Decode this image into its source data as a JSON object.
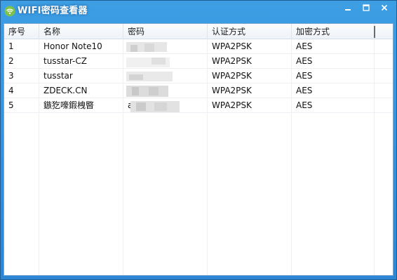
{
  "window": {
    "title": "WIFI密码查看器"
  },
  "table": {
    "columns": [
      "序号",
      "名称",
      "密码",
      "认证方式",
      "加密方式"
    ],
    "rows": [
      {
        "index": "1",
        "name": "Honor Note10",
        "password": "",
        "auth": "WPA2PSK",
        "cipher": "AES"
      },
      {
        "index": "2",
        "name": "tusstar-CZ",
        "password": "",
        "auth": "WPA2PSK",
        "cipher": "AES"
      },
      {
        "index": "3",
        "name": "tusstar",
        "password": "",
        "auth": "WPA2PSK",
        "cipher": "AES"
      },
      {
        "index": "4",
        "name": "ZDECK.CN",
        "password": "",
        "auth": "WPA2PSK",
        "cipher": "AES"
      },
      {
        "index": "5",
        "name": "鏃犵嚎鍜栧暋",
        "password": "a",
        "auth": "WPA2PSK",
        "cipher": "AES"
      }
    ]
  },
  "icons": {
    "app": "wifi-icon",
    "minimize": "minimize-icon",
    "maximize": "maximize-icon",
    "close": "close-icon"
  },
  "colors": {
    "titlebar": "#3292dc",
    "header_bg": "#f4f7fa",
    "border": "#7aa7d1"
  }
}
